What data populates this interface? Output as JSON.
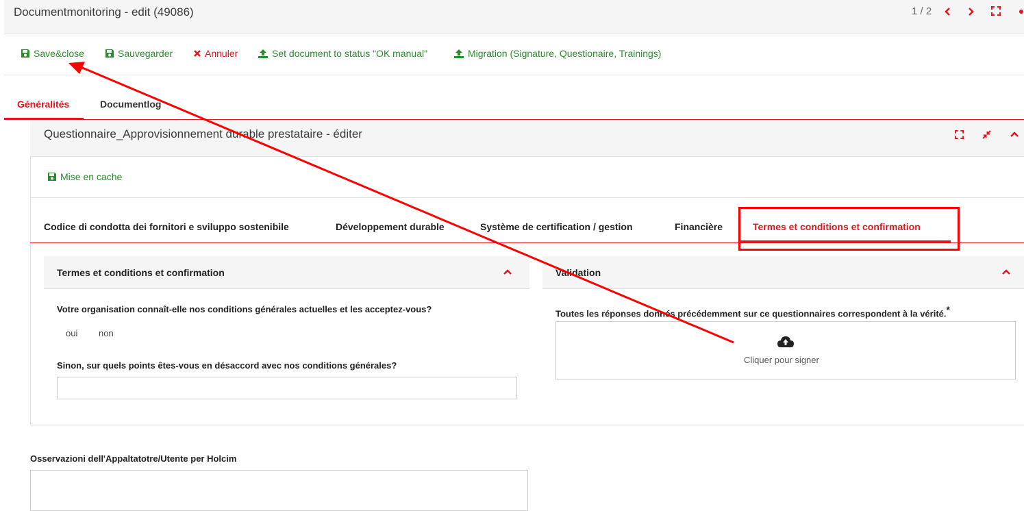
{
  "header": {
    "title": "Documentmonitoring - edit (49086)",
    "pager": "1 / 2"
  },
  "toolbar": {
    "save_close": "Save&close",
    "save": "Sauvegarder",
    "cancel": "Annuler",
    "set_ok": "Set document to status \"OK manual\"",
    "migration": "Migration (Signature, Questionaire, Trainings)"
  },
  "main_tabs": [
    {
      "label": "Généralités",
      "active": true
    },
    {
      "label": "Documentlog",
      "active": false
    }
  ],
  "panel": {
    "title": "Questionnaire_Approvisionnement durable prestataire - éditer",
    "cache_label": "Mise en cache"
  },
  "sub_tabs": [
    {
      "label": "Codice di condotta dei fornitori e sviluppo sostenibile",
      "active": false
    },
    {
      "label": "Développement durable",
      "active": false
    },
    {
      "label": "Système de certification / gestion",
      "active": false
    },
    {
      "label": "Financière",
      "active": false
    },
    {
      "label": "Termes et conditions et confirmation",
      "active": true
    }
  ],
  "terms": {
    "title": "Termes et conditions et confirmation",
    "question1": "Votre organisation connaît-elle nos conditions générales actuelles et les acceptez-vous?",
    "opt_yes": "oui",
    "opt_no": "non",
    "question2": "Sinon, sur quels points êtes-vous en désaccord avec nos conditions générales?",
    "answer2": ""
  },
  "validation": {
    "title": "Validation",
    "statement": "Toutes les réponses donnés précédemment sur ce questionnaires correspondent à la vérité.",
    "required_mark": "*",
    "sign_label": "Cliquer pour signer"
  },
  "observations": {
    "label": "Osservazioni dell'Appaltatotre/Utente per Holcim",
    "value": ""
  },
  "colors": {
    "accent": "#e2141c",
    "success": "#2b8a2b",
    "annotation": "#ff0000"
  },
  "icons": {
    "save": "floppy-disk-icon",
    "cancel": "x-icon",
    "upload": "upload-icon",
    "cloud_upload": "cloud-upload-icon",
    "fullscreen": "expand-icon",
    "collapse": "compress-icon",
    "chevron": "chevron-up-icon"
  }
}
